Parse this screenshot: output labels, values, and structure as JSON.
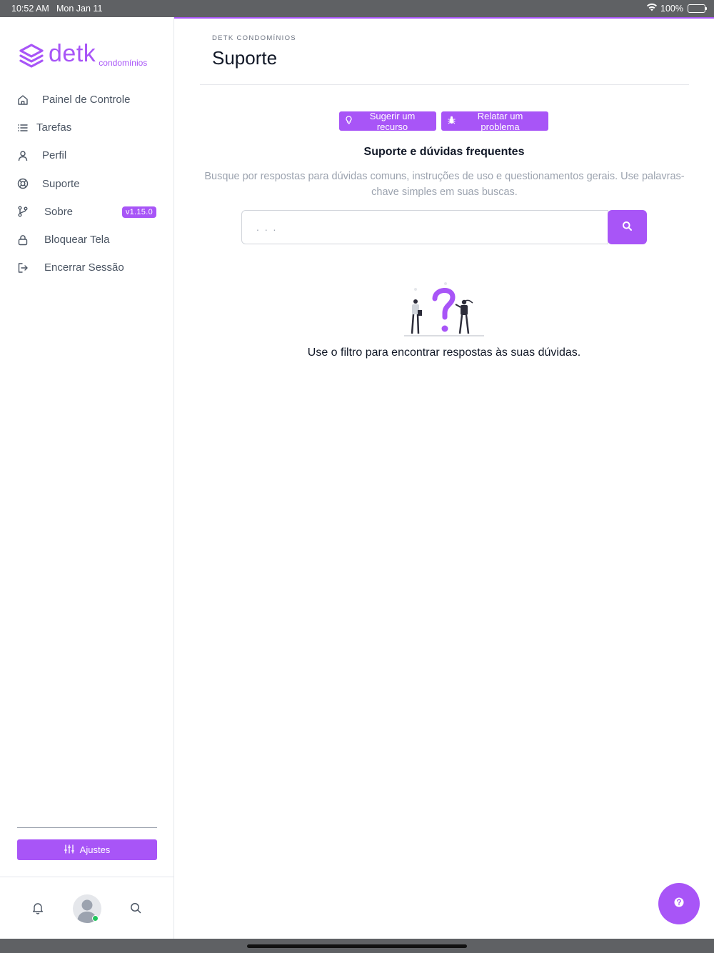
{
  "status_bar": {
    "time": "10:52 AM",
    "date": "Mon Jan 11",
    "battery": "100%"
  },
  "brand": {
    "name": "detk",
    "sub": "condomínios",
    "color": "#a855f7"
  },
  "sidebar": {
    "items": [
      {
        "label": "Painel de Controle",
        "icon": "home-icon"
      },
      {
        "label": "Tarefas",
        "icon": "list-icon"
      },
      {
        "label": "Perfil",
        "icon": "user-icon"
      },
      {
        "label": "Suporte",
        "icon": "lifebuoy-icon"
      },
      {
        "label": "Sobre",
        "icon": "git-branch-icon",
        "badge": "v1.15.0"
      },
      {
        "label": "Bloquear Tela",
        "icon": "lock-icon"
      },
      {
        "label": "Encerrar Sessão",
        "icon": "logout-icon"
      }
    ],
    "settings_label": "Ajustes"
  },
  "page": {
    "breadcrumb": "DETK CONDOMÍNIOS",
    "title": "Suporte",
    "actions": {
      "suggest": "Sugerir um recurso",
      "report": "Relatar um problema"
    },
    "section_title": "Suporte e dúvidas frequentes",
    "section_desc": "Busque por respostas para dúvidas comuns, instruções de uso e questionamentos gerais. Use palavras-chave simples em suas buscas.",
    "search": {
      "placeholder": ". . .",
      "value": ""
    },
    "empty_text": "Use o filtro para encontrar respostas às suas dúvidas."
  }
}
